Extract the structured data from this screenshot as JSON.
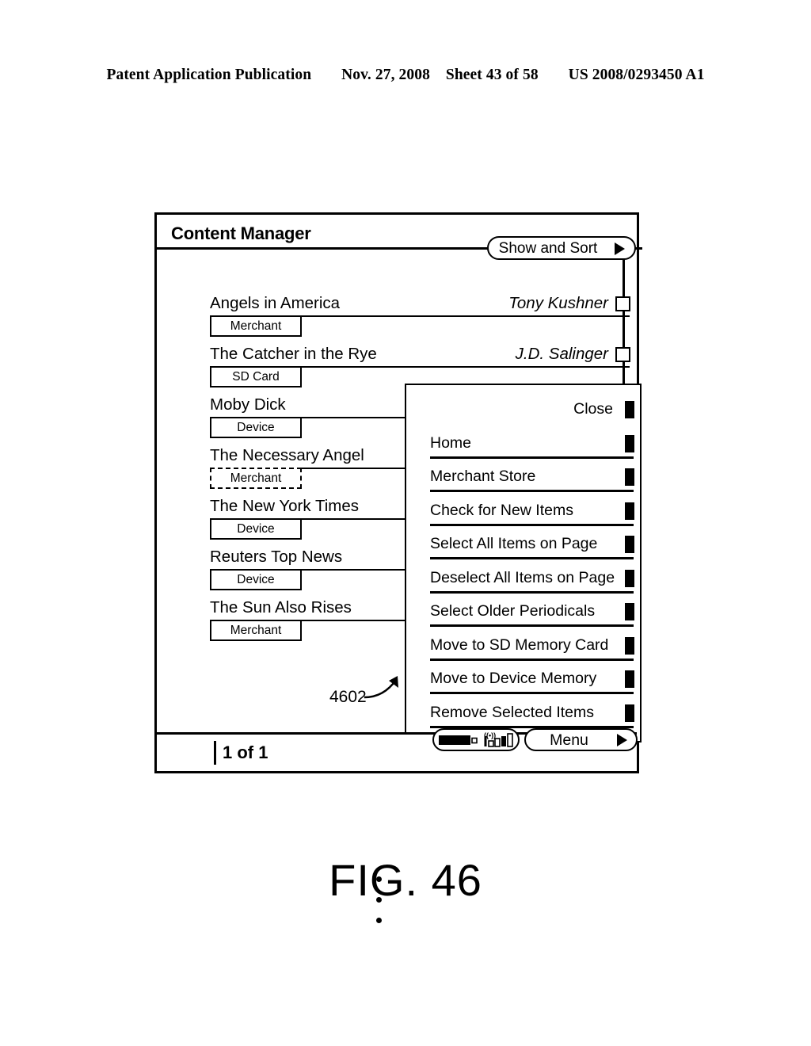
{
  "patent_header": {
    "publication": "Patent Application Publication",
    "date": "Nov. 27, 2008",
    "sheet": "Sheet 43 of 58",
    "number": "US 2008/0293450 A1"
  },
  "figure": {
    "caption": "FIG. 46",
    "reference_numeral": "4602"
  },
  "screen": {
    "title": "Content Manager",
    "show_and_sort": {
      "label": "Show and Sort",
      "arrow_icon": "triangle-right-icon"
    },
    "items": [
      {
        "title": "Angels in America",
        "author": "Tony Kushner",
        "location": "Merchant",
        "checked": false,
        "focused": false
      },
      {
        "title": "The Catcher in the Rye",
        "author": "J.D. Salinger",
        "location": "SD Card",
        "checked": false,
        "focused": false
      },
      {
        "title": "Moby Dick",
        "author": "",
        "location": "Device",
        "checked": false,
        "focused": false
      },
      {
        "title": "The Necessary Angel",
        "author": "",
        "location": "Merchant",
        "checked": false,
        "focused": true
      },
      {
        "title": "The New York Times",
        "author": "",
        "location": "Device",
        "checked": false,
        "focused": false
      },
      {
        "title": "Reuters Top News",
        "author": "",
        "location": "Device",
        "checked": false,
        "focused": false
      },
      {
        "title": "The Sun Also Rises",
        "author": "",
        "location": "Merchant",
        "checked": false,
        "focused": false
      }
    ],
    "ellipsis_dots": 3,
    "statusbar": {
      "page_indicator": "1 of 1",
      "battery_icon": "battery-full-icon",
      "signal_icon": "wireless-signal-icon",
      "menu_button": {
        "label": "Menu",
        "arrow_icon": "triangle-right-icon"
      }
    }
  },
  "popup_menu": {
    "items": [
      {
        "label": "Close",
        "marker": "square-marker-icon",
        "underline": false
      },
      {
        "label": "Home",
        "marker": "square-marker-icon",
        "underline": true
      },
      {
        "label": "Merchant Store",
        "marker": "square-marker-icon",
        "underline": true
      },
      {
        "label": "Check for New Items",
        "marker": "square-marker-icon",
        "underline": true
      },
      {
        "label": "Select All Items on Page",
        "marker": "square-marker-icon",
        "underline": true
      },
      {
        "label": "Deselect All Items on Page",
        "marker": "square-marker-icon",
        "underline": true
      },
      {
        "label": "Select Older Periodicals",
        "marker": "square-marker-icon",
        "underline": true
      },
      {
        "label": "Move to SD Memory Card",
        "marker": "square-marker-icon",
        "underline": true
      },
      {
        "label": "Move to Device Memory",
        "marker": "square-marker-icon",
        "underline": true
      },
      {
        "label": "Remove Selected Items",
        "marker": "square-marker-icon",
        "underline": true
      }
    ]
  },
  "colors": {
    "ink": "#000000",
    "paper": "#ffffff"
  }
}
